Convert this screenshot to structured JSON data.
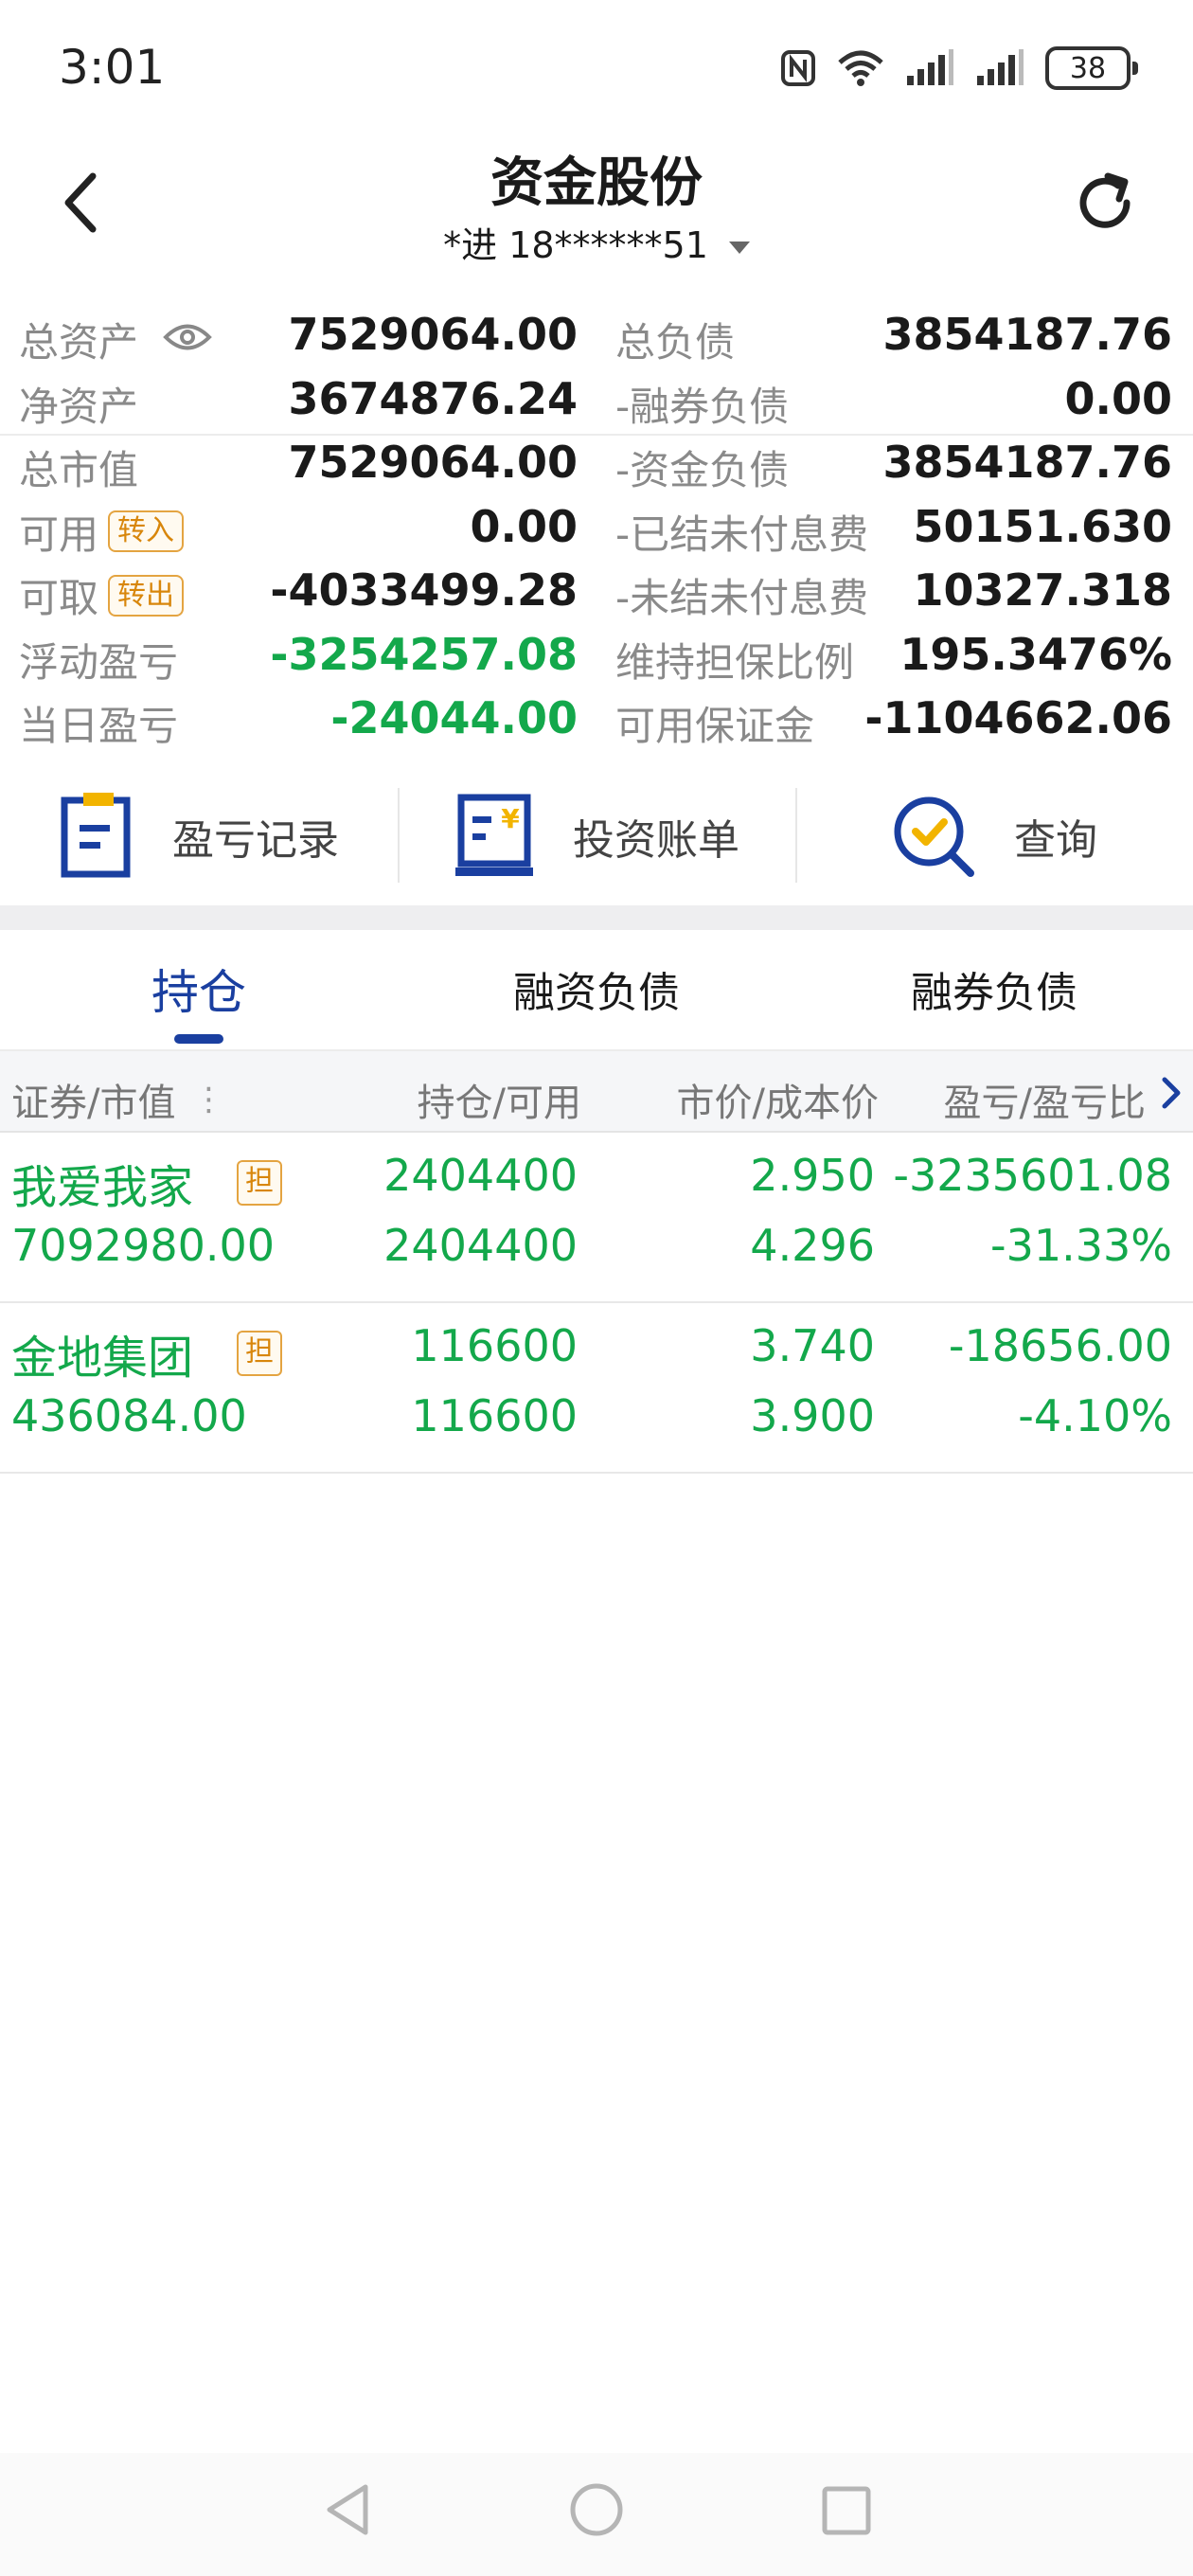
{
  "status_bar": {
    "time": "3:01",
    "battery": "38",
    "icons": [
      "nfc-icon",
      "wifi-icon",
      "signal-icon",
      "signal-icon",
      "battery-icon"
    ]
  },
  "header": {
    "title": "资金股份",
    "account": "*进 18******51",
    "back_icon": "chevron-left-icon",
    "refresh_icon": "refresh-icon"
  },
  "summary": {
    "left": [
      {
        "label": "总资产",
        "value": "7529064.00"
      },
      {
        "label": "净资产",
        "value": "3674876.24"
      },
      {
        "label": "总市值",
        "value": "7529064.00"
      },
      {
        "label": "可用",
        "badge": "转入",
        "value": "0.00"
      },
      {
        "label": "可取",
        "badge": "转出",
        "value": "-4033499.28"
      },
      {
        "label": "浮动盈亏",
        "value": "-3254257.08"
      },
      {
        "label": "当日盈亏",
        "value": "-24044.00"
      }
    ],
    "right": [
      {
        "label": "总负债",
        "value": "3854187.76"
      },
      {
        "label": "-融券负债",
        "value": "0.00"
      },
      {
        "label": "-资金负债",
        "value": "3854187.76"
      },
      {
        "label": "-已结未付息费",
        "value": "50151.630"
      },
      {
        "label": "-未结未付息费",
        "value": "10327.318"
      },
      {
        "label": "维持担保比例",
        "value": "195.3476%"
      },
      {
        "label": "可用保证金",
        "value": "-1104662.06"
      }
    ]
  },
  "actions": [
    {
      "label": "盈亏记录",
      "icon": "record-icon"
    },
    {
      "label": "投资账单",
      "icon": "bill-icon"
    },
    {
      "label": "查询",
      "icon": "search-check-icon"
    }
  ],
  "tabs": [
    {
      "label": "持仓",
      "active": true
    },
    {
      "label": "融资负债",
      "active": false
    },
    {
      "label": "融券负债",
      "active": false
    }
  ],
  "table": {
    "headers": [
      "证券/市值",
      "持仓/可用",
      "市价/成本价",
      "盈亏/盈亏比"
    ],
    "rows": [
      {
        "name": "我爱我家",
        "tag": "担",
        "market_value": "7092980.00",
        "holding": "2404400",
        "available": "2404400",
        "price": "2.950",
        "cost": "4.296",
        "pnl": "-3235601.08",
        "pnl_ratio": "-31.33%"
      },
      {
        "name": "金地集团",
        "tag": "担",
        "market_value": "436084.00",
        "holding": "116600",
        "available": "116600",
        "price": "3.740",
        "cost": "3.900",
        "pnl": "-18656.00",
        "pnl_ratio": "-4.10%"
      }
    ]
  },
  "colors": {
    "accent": "#1a3fa0",
    "loss_green": "#13a84b",
    "badge_orange": "#d8860b",
    "check_yellow": "#f2b400"
  }
}
